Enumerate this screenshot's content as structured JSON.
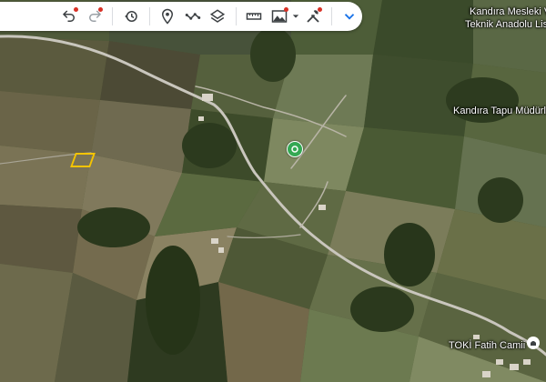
{
  "map": {
    "type": "satellite",
    "colors": {
      "field_dark": "#3b4a2a",
      "field_light": "#8a8a62",
      "forest": "#2d3b1f",
      "road": "#c9c6bd",
      "parcel_highlight": "#f5c400",
      "poi_green": "#34a853",
      "notification_dot": "#d93025"
    }
  },
  "toolbar": {
    "buttons": [
      {
        "name": "undo-button",
        "icon": "undo-icon",
        "has_dot": true
      },
      {
        "name": "redo-button",
        "icon": "redo-icon",
        "has_dot": true
      },
      {
        "name": "history-button",
        "icon": "history-icon",
        "has_dot": false
      },
      {
        "name": "add-placemark-button",
        "icon": "placemark-icon",
        "has_dot": false
      },
      {
        "name": "draw-path-button",
        "icon": "path-icon",
        "has_dot": false
      },
      {
        "name": "layers-button",
        "icon": "layers-icon",
        "has_dot": false
      },
      {
        "name": "measure-button",
        "icon": "ruler-icon",
        "has_dot": false
      },
      {
        "name": "imagery-button",
        "icon": "image-icon",
        "has_dot": true
      },
      {
        "name": "tools-button",
        "icon": "tools-icon",
        "has_dot": true
      }
    ],
    "collapse_icon": "chevron-down-icon"
  },
  "labels": {
    "school_line1": "Kandıra Mesleki V",
    "school_line2": "Teknik Anadolu Lise",
    "land_registry": "Kandıra Tapu Müdürlü",
    "mosque": "TOKİ Fatih Camii"
  }
}
